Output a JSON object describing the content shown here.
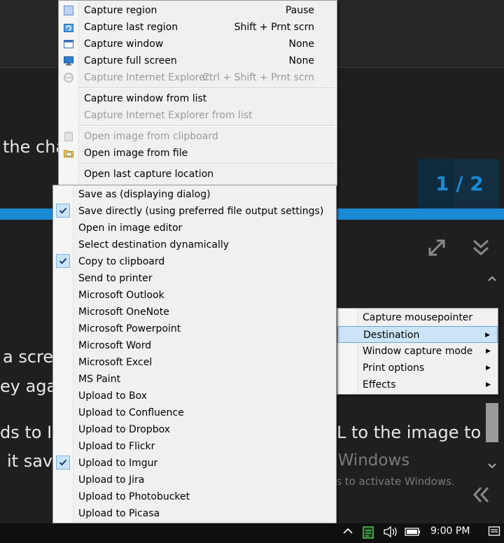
{
  "background": {
    "text_1": "the cha",
    "text_2": "a scre",
    "text_3": "ey aga",
    "text_4": "ds to IM",
    "text_5": "L to the image to",
    "text_6": "it sav",
    "pager": "1 / 2",
    "activation_title": "Activate Windows",
    "activation_subtitle": "Go to Settings to activate Windows.",
    "clock": "9:00 PM",
    "accent": "#1a8ad4"
  },
  "capture_menu": {
    "items": [
      {
        "label": "Capture region",
        "shortcut": "Pause",
        "icon": "region-icon",
        "disabled": false
      },
      {
        "label": "Capture last region",
        "shortcut": "Shift + Prnt scrn",
        "icon": "last-region-icon",
        "disabled": false
      },
      {
        "label": "Capture window",
        "shortcut": "None",
        "icon": "window-icon",
        "disabled": false
      },
      {
        "label": "Capture full screen",
        "shortcut": "None",
        "icon": "monitor-icon",
        "disabled": false
      },
      {
        "label": "Capture Internet Explorer",
        "shortcut": "Ctrl + Shift + Prnt scrn",
        "icon": "ie-icon",
        "disabled": true
      },
      {
        "label": "Capture window from list",
        "shortcut": "",
        "disabled": false
      },
      {
        "label": "Capture Internet Explorer from list",
        "shortcut": "",
        "disabled": true
      },
      {
        "label": "Open image from clipboard",
        "shortcut": "",
        "icon": "clipboard-icon",
        "disabled": true
      },
      {
        "label": "Open image from file",
        "shortcut": "",
        "icon": "folder-icon",
        "disabled": false
      },
      {
        "label": "Open last capture location",
        "shortcut": "",
        "disabled": false
      }
    ]
  },
  "destination_menu": {
    "items": [
      {
        "label": "Save as (displaying dialog)",
        "checked": false
      },
      {
        "label": "Save directly (using preferred file output settings)",
        "checked": true
      },
      {
        "label": "Open in image editor",
        "checked": false
      },
      {
        "label": "Select destination dynamically",
        "checked": false
      },
      {
        "label": "Copy to clipboard",
        "checked": true
      },
      {
        "label": "Send to printer",
        "checked": false
      },
      {
        "label": "Microsoft Outlook",
        "checked": false
      },
      {
        "label": "Microsoft OneNote",
        "checked": false
      },
      {
        "label": "Microsoft Powerpoint",
        "checked": false
      },
      {
        "label": "Microsoft Word",
        "checked": false
      },
      {
        "label": "Microsoft Excel",
        "checked": false
      },
      {
        "label": "MS Paint",
        "checked": false
      },
      {
        "label": "Upload to Box",
        "checked": false
      },
      {
        "label": "Upload to Confluence",
        "checked": false
      },
      {
        "label": "Upload to Dropbox",
        "checked": false
      },
      {
        "label": "Upload to Flickr",
        "checked": false
      },
      {
        "label": "Upload to Imgur",
        "checked": true
      },
      {
        "label": "Upload to Jira",
        "checked": false
      },
      {
        "label": "Upload to Photobucket",
        "checked": false
      },
      {
        "label": "Upload to Picasa",
        "checked": false
      }
    ]
  },
  "quick_settings_menu": {
    "items": [
      {
        "label": "Capture mousepointer",
        "submenu": false,
        "highlighted": false
      },
      {
        "label": "Destination",
        "submenu": true,
        "highlighted": true
      },
      {
        "label": "Window capture mode",
        "submenu": true,
        "highlighted": false
      },
      {
        "label": "Print options",
        "submenu": true,
        "highlighted": false
      },
      {
        "label": "Effects",
        "submenu": true,
        "highlighted": false
      }
    ]
  }
}
